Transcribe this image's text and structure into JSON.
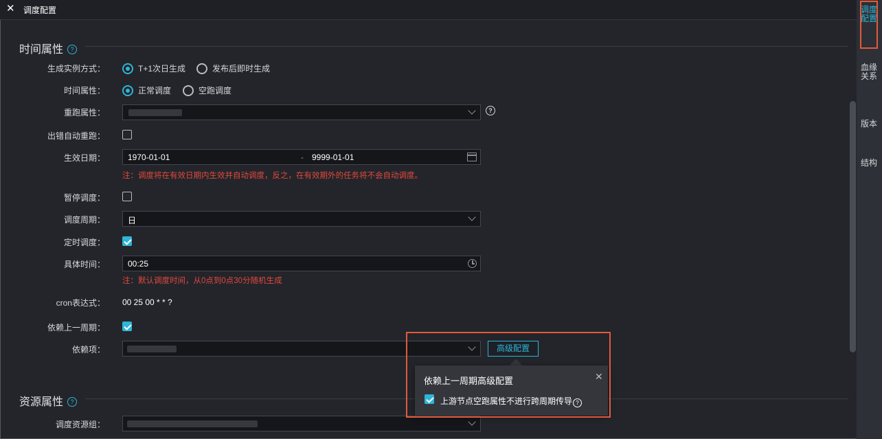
{
  "topbar": {
    "close_icon": "close-icon",
    "title": "调度配置"
  },
  "right_rail": [
    {
      "label": "调度配置",
      "active": true
    },
    {
      "label": "血缘关系",
      "active": false
    },
    {
      "label": "版本",
      "active": false
    },
    {
      "label": "结构",
      "active": false
    }
  ],
  "sections": {
    "time": "时间属性",
    "resource": "资源属性"
  },
  "form": {
    "instance_mode": {
      "label": "生成实例方式：",
      "options": [
        "T+1次日生成",
        "发布后即时生成"
      ],
      "selected": "T+1次日生成"
    },
    "time_attr": {
      "label": "时间属性：",
      "options": [
        "正常调度",
        "空跑调度"
      ],
      "selected": "正常调度"
    },
    "rerun": {
      "label": "重跑属性："
    },
    "auto_rerun": {
      "label": "出错自动重跑：",
      "checked": false
    },
    "effective_date": {
      "label": "生效日期：",
      "start": "1970-01-01",
      "sep": "-",
      "end": "9999-01-01",
      "note": "注：调度将在有效日期内生效并自动调度，反之，在有效期外的任务将不会自动调度。"
    },
    "pause": {
      "label": "暂停调度：",
      "checked": false
    },
    "cycle": {
      "label": "调度周期：",
      "value": "日"
    },
    "timed": {
      "label": "定时调度：",
      "checked": true
    },
    "specific_time": {
      "label": "具体时间：",
      "value": "00:25",
      "note": "注：默认调度时间，从0点到0点30分随机生成"
    },
    "cron": {
      "label": "cron表达式：",
      "value": "00 25 00 * * ?"
    },
    "depend_last": {
      "label": "依赖上一周期：",
      "checked": true
    },
    "depend_item": {
      "label": "依赖项：",
      "button": "高级配置"
    },
    "resource_group": {
      "label": "调度资源组："
    }
  },
  "popover": {
    "title": "依赖上一周期高级配置",
    "checkbox_label": "上游节点空跑属性不进行跨周期传导",
    "checked": true
  },
  "colors": {
    "accent": "#2fb5d6",
    "warning": "#e2483d",
    "highlight": "#e35a3b"
  }
}
